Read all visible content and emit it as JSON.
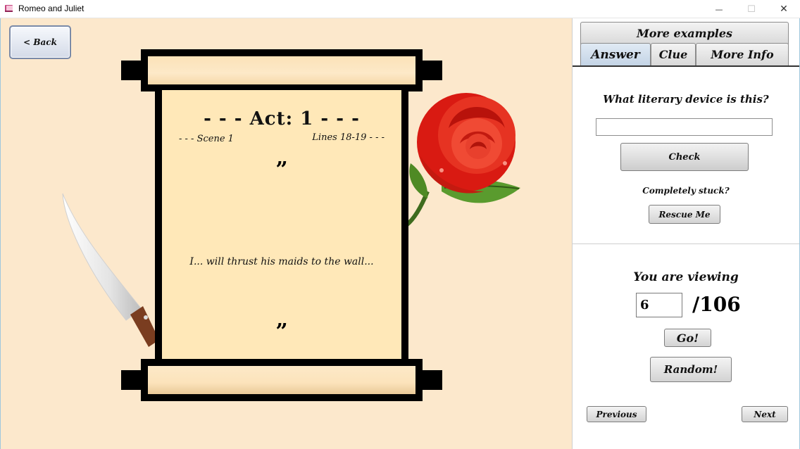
{
  "window": {
    "title": "Romeo and Juliet",
    "minimize_glyph": "—",
    "maximize_glyph": "☐",
    "close_glyph": "✕",
    "icon": "book-icon"
  },
  "stage": {
    "back_label": "< Back",
    "scroll": {
      "act": "- - - Act: 1  - - -",
      "scene": "- - - Scene 1",
      "lines": "Lines 18-19 - - -",
      "open_quote": "”",
      "close_quote": "”",
      "passage": "I... will thrust his maids to the wall..."
    },
    "decorations": [
      "knife-image",
      "rose-image"
    ],
    "colors": {
      "background": "#fce8cc",
      "paper": "#ffe8b8",
      "frame": "#000000"
    }
  },
  "panel": {
    "tabs": {
      "more_examples": "More examples",
      "answer": "Answer",
      "clue": "Clue",
      "more_info": "More Info",
      "active": "Answer"
    },
    "question": "What literary device is this?",
    "answer_value": "",
    "check_label": "Check",
    "stuck_text": "Completely stuck?",
    "rescue_label": "Rescue Me",
    "viewing_label": "You are viewing",
    "current_page": "6",
    "total_pages": "/106",
    "go_label": "Go!",
    "random_label": "Random!",
    "previous_label": "Previous",
    "next_label": "Next"
  }
}
